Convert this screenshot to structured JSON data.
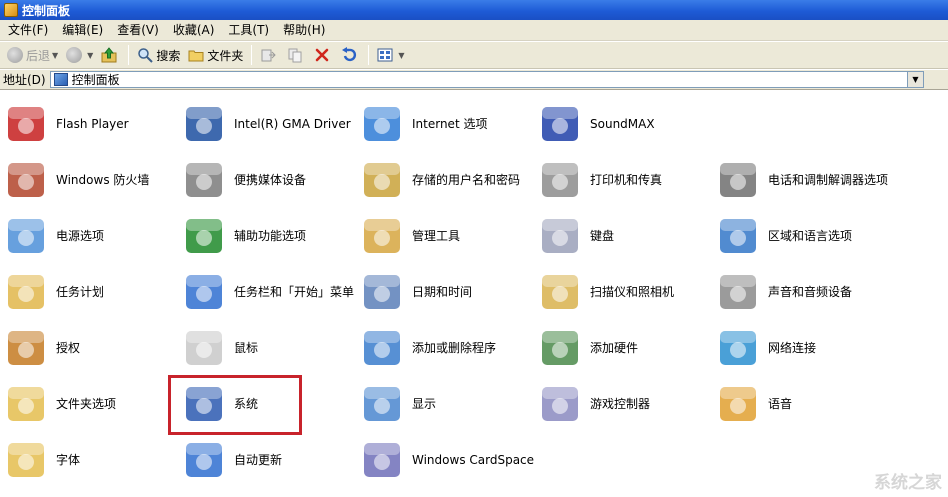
{
  "window": {
    "title": "控制面板"
  },
  "menu": [
    "文件(F)",
    "编辑(E)",
    "查看(V)",
    "收藏(A)",
    "工具(T)",
    "帮助(H)"
  ],
  "toolbar": {
    "back": "后退",
    "search": "搜索",
    "folders": "文件夹"
  },
  "address": {
    "label": "地址(D)",
    "value": "控制面板"
  },
  "items": [
    {
      "label": "Flash Player",
      "icon": "flash-player-icon",
      "color": "#c61e1e"
    },
    {
      "label": "Intel(R) GMA Driver",
      "icon": "intel-gma-icon",
      "color": "#1c4fa0"
    },
    {
      "label": "Internet 选项",
      "icon": "internet-options-icon",
      "color": "#2e7bd6"
    },
    {
      "label": "SoundMAX",
      "icon": "soundmax-icon",
      "color": "#1e3fa8"
    },
    {
      "label": "Windows 防火墙",
      "icon": "firewall-icon",
      "color": "#b1442a"
    },
    {
      "label": "便携媒体设备",
      "icon": "portable-media-icon",
      "color": "#7b7b7b"
    },
    {
      "label": "存储的用户名和密码",
      "icon": "stored-passwords-icon",
      "color": "#c9a239"
    },
    {
      "label": "打印机和传真",
      "icon": "printer-icon",
      "color": "#8c8c8c"
    },
    {
      "label": "电话和调制解调器选项",
      "icon": "phone-modem-icon",
      "color": "#6e6e6e"
    },
    {
      "label": "电源选项",
      "icon": "power-options-icon",
      "color": "#4c8fd8"
    },
    {
      "label": "辅助功能选项",
      "icon": "accessibility-icon",
      "color": "#1f8a2a"
    },
    {
      "label": "管理工具",
      "icon": "admin-tools-icon",
      "color": "#d6a640"
    },
    {
      "label": "键盘",
      "icon": "keyboard-icon",
      "color": "#9aa0b8"
    },
    {
      "label": "区域和语言选项",
      "icon": "region-language-icon",
      "color": "#3277c8"
    },
    {
      "label": "任务计划",
      "icon": "scheduled-tasks-icon",
      "color": "#e0b64a"
    },
    {
      "label": "任务栏和「开始」菜单",
      "icon": "taskbar-start-menu-icon",
      "color": "#2f6fd0"
    },
    {
      "label": "日期和时间",
      "icon": "date-time-icon",
      "color": "#5a7fb8"
    },
    {
      "label": "扫描仪和照相机",
      "icon": "scanner-camera-icon",
      "color": "#d8b24c"
    },
    {
      "label": "声音和音频设备",
      "icon": "sound-audio-icon",
      "color": "#8a8a8a"
    },
    {
      "label": "授权",
      "icon": "license-icon",
      "color": "#c47a22"
    },
    {
      "label": "鼠标",
      "icon": "mouse-icon",
      "color": "#c8c8c8"
    },
    {
      "label": "添加或删除程序",
      "icon": "add-remove-programs-icon",
      "color": "#3a7ccc"
    },
    {
      "label": "添加硬件",
      "icon": "add-hardware-icon",
      "color": "#4a8a4a"
    },
    {
      "label": "网络连接",
      "icon": "network-connections-icon",
      "color": "#2a8fd0"
    },
    {
      "label": "文件夹选项",
      "icon": "folder-options-icon",
      "color": "#e4bd4e"
    },
    {
      "label": "系统",
      "icon": "system-icon",
      "color": "#2b59b0"
    },
    {
      "label": "显示",
      "icon": "display-icon",
      "color": "#4a86cf"
    },
    {
      "label": "游戏控制器",
      "icon": "game-controllers-icon",
      "color": "#8a8ac0"
    },
    {
      "label": "语音",
      "icon": "speech-icon",
      "color": "#e0a030"
    },
    {
      "label": "字体",
      "icon": "fonts-icon",
      "color": "#e4bd4e"
    },
    {
      "label": "自动更新",
      "icon": "automatic-updates-icon",
      "color": "#2f6fd0"
    },
    {
      "label": "Windows CardSpace",
      "icon": "cardspace-icon",
      "color": "#6f6fb8"
    }
  ],
  "watermark": "系统之家"
}
